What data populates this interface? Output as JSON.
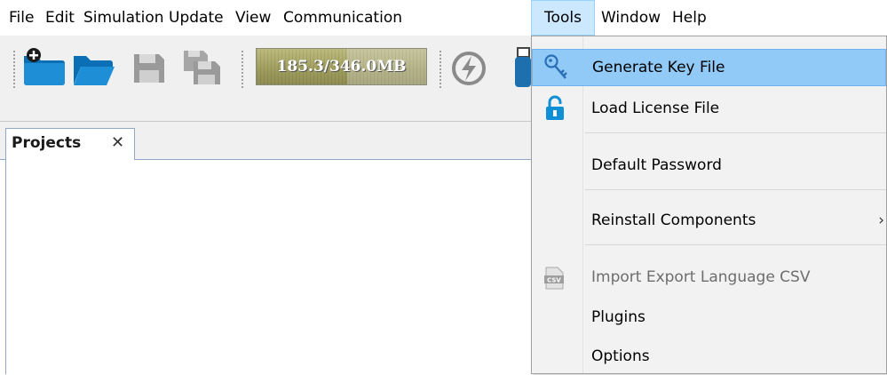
{
  "menubar": {
    "items": [
      "File",
      "Edit",
      "Simulation",
      "Update",
      "View",
      "Communication",
      "Tools",
      "Window",
      "Help"
    ],
    "open_item": "Tools"
  },
  "toolbar": {
    "buttons": [
      "new-project-icon",
      "open-project-icon",
      "save-icon",
      "save-all-icon",
      "flash-icon",
      "usb-icon"
    ],
    "memory": {
      "text": "185.3/346.0MB",
      "used": 185.3,
      "total": 346.0
    }
  },
  "projects_panel": {
    "tab_label": "Projects",
    "close_glyph": "✕"
  },
  "tools_menu": {
    "items": [
      {
        "label": "Generate Key File",
        "icon": "key-icon",
        "highlighted": true
      },
      {
        "label": "Load License File",
        "icon": "unlock-icon"
      },
      {
        "label": "Default Password"
      },
      {
        "label": "Reinstall Components",
        "submenu_arrow": "›"
      },
      {
        "label": "Import Export Language CSV",
        "icon": "csv-file-icon",
        "disabled": true
      },
      {
        "label": "Plugins"
      },
      {
        "label": "Options"
      }
    ]
  },
  "colors": {
    "menu_highlight": "#91c9f7",
    "menubar_open": "#cce8ff",
    "accent_blue": "#0f8fd6"
  }
}
